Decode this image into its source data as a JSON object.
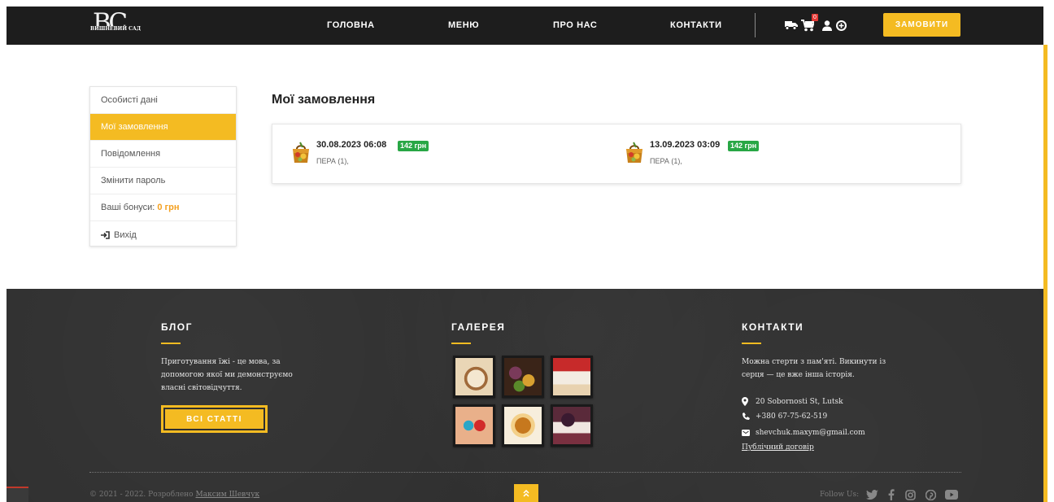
{
  "header": {
    "logo_text": "BC",
    "logo_subtitle": "ВИШНЕВИЙ САД",
    "nav": [
      "ГОЛОВНА",
      "МЕНЮ",
      "ПРО НАС",
      "КОНТАКТИ"
    ],
    "cart_count": "0",
    "order_button": "ЗАМОВИТИ",
    "icons": [
      "delivery-truck-icon",
      "cart-icon",
      "user-icon",
      "language-icon"
    ]
  },
  "sidebar": {
    "items": [
      {
        "label": "Особисті дані",
        "active": false
      },
      {
        "label": "Мої замовлення",
        "active": true
      },
      {
        "label": "Повідомлення",
        "active": false
      },
      {
        "label": "Змінити пароль",
        "active": false
      }
    ],
    "bonus_label": "Ваші бонуси:",
    "bonus_value": "0 грн",
    "logout_label": "Вихід"
  },
  "main": {
    "title": "Мої замовлення",
    "orders": [
      {
        "date": "30.08.2023 06:08",
        "price": "142 грн",
        "items": "ПЕРА (1),"
      },
      {
        "date": "13.09.2023 03:09",
        "price": "142 грн",
        "items": "ПЕРА (1),"
      }
    ]
  },
  "footer": {
    "blog": {
      "title": "БЛОГ",
      "text_lines": [
        "Приготування їжі - це мова, за",
        "допомогою якої ми демонструємо",
        "власні світовідчуття."
      ],
      "button": "ВСІ СТАТТІ"
    },
    "gallery": {
      "title": "ГАЛЕРЕЯ"
    },
    "contacts": {
      "title": "КОНТАКТИ",
      "text_lines": [
        "Можна стерти з пам'яті. Викинути із",
        "серця — це вже інша історія."
      ],
      "address": "20 Sobornosti St, Lutsk",
      "phone": "+380 67-75-62-519",
      "email": "shevchuk.maxym@gmail.com",
      "contract": "Публічний договір"
    },
    "copyright_prefix": "© 2021 - 2022. Розроблено",
    "copyright_author": "Максим Шевчук",
    "follow_label": "Follow Us:",
    "social": [
      "twitter-icon",
      "facebook-icon",
      "instagram-icon",
      "pinterest-icon",
      "youtube-icon"
    ]
  },
  "colors": {
    "accent": "#f4bb22",
    "header_bg": "#1d1d1d",
    "footer_bg": "#2f2f2f",
    "price_badge": "#28a745"
  }
}
